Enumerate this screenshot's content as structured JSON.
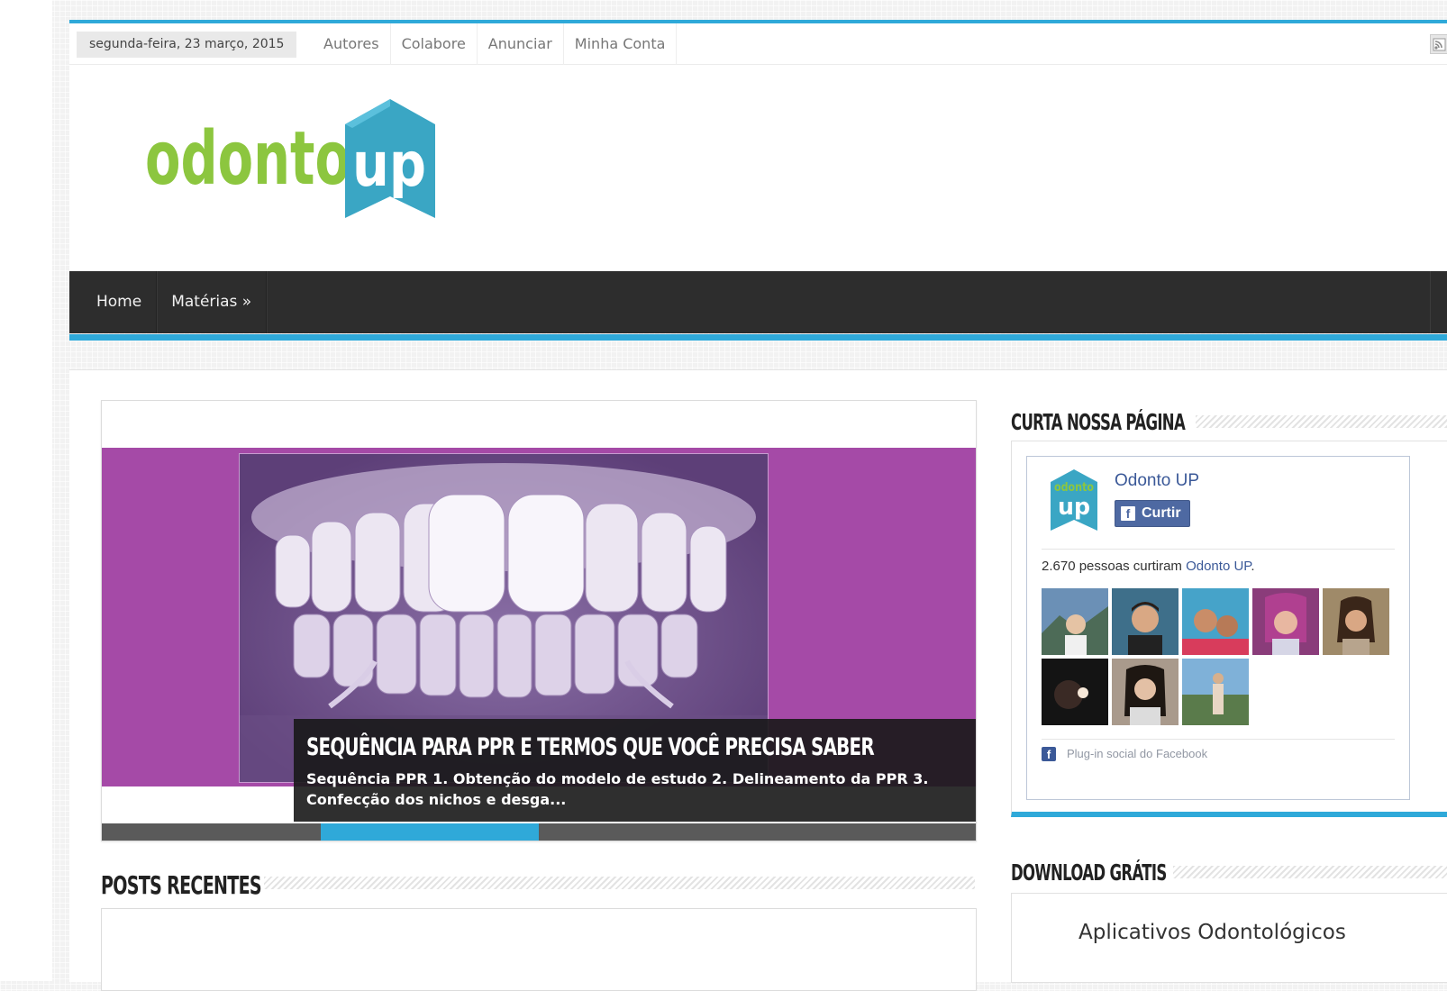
{
  "topbar": {
    "date": "segunda-feira, 23 março, 2015",
    "links": [
      "Autores",
      "Colabore",
      "Anunciar",
      "Minha Conta"
    ]
  },
  "logo": {
    "text_left": "odonto",
    "text_right": "up",
    "colors": {
      "green": "#8cc63f",
      "blue": "#3aa6c4"
    }
  },
  "mainnav": {
    "items": [
      "Home",
      "Matérias »"
    ]
  },
  "slider": {
    "title": "Sequência para PPR e termos que você precisa saber",
    "excerpt": "Sequência PPR 1. Obtenção do modelo de estudo 2. Delineamento da PPR 3. Confecção dos nichos e desga...",
    "slides": 4,
    "active_slide": 2,
    "bg_color": "#a54aa7"
  },
  "sections": {
    "recent": "Posts Recentes"
  },
  "sidebar": {
    "fb_widget": {
      "title": "Curta nossa página",
      "page_name": "Odonto UP",
      "like_label": "Curtir",
      "count_text": "2.670 pessoas curtiram ",
      "count_page": "Odonto UP",
      "count_end": ".",
      "plugin_label": "Plug-in social do Facebook",
      "faces": 8
    },
    "download": {
      "title": "Download Grátis",
      "item": "Aplicativos Odontológicos"
    }
  },
  "colors": {
    "accent": "#2fa9d9",
    "nav_bg": "#2d2d2d",
    "fb_blue": "#3b5998"
  }
}
